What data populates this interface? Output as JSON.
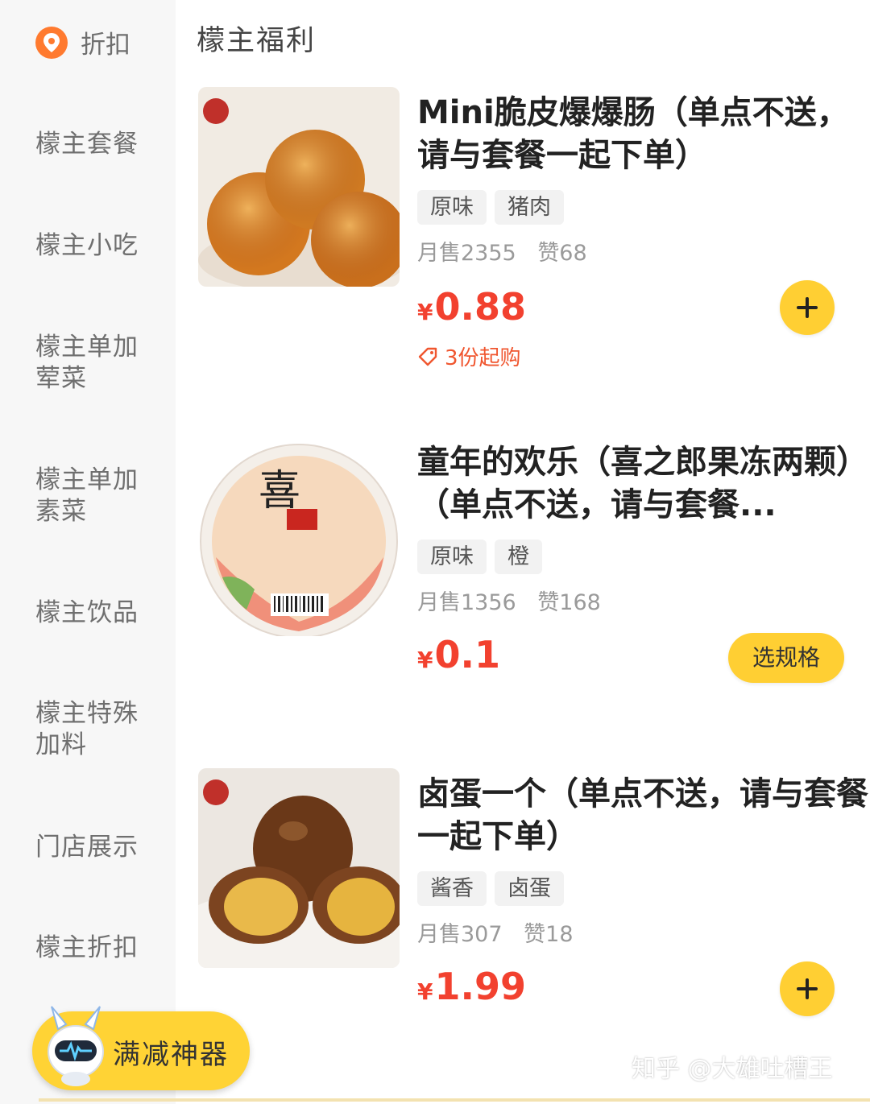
{
  "sidebar": {
    "active": "折扣",
    "items": [
      "檬主套餐",
      "檬主小吃",
      "檬主单加荤菜",
      "檬主单加素菜",
      "檬主饮品",
      "檬主特殊加料",
      "门店展示",
      "檬主折扣"
    ]
  },
  "section_title": "檬主福利",
  "products": [
    {
      "name": "Mini脆皮爆爆肠（单点不送，请与套餐一起下单）",
      "tags": [
        "原味",
        "猪肉"
      ],
      "monthly_sales": "月售2355",
      "likes": "赞68",
      "currency": "¥",
      "price": "0.88",
      "min_buy": "3份起购",
      "action": "+",
      "image": "fried-sausage-balls"
    },
    {
      "name": "童年的欢乐（喜之郎果冻两颗）（单点不送，请与套餐...",
      "tags": [
        "原味",
        "橙"
      ],
      "monthly_sales": "月售1356",
      "likes": "赞168",
      "currency": "¥",
      "price": "0.1",
      "action": "选规格",
      "image": "jelly-cup"
    },
    {
      "name": "卤蛋一个（单点不送，请与套餐一起下单）",
      "tags": [
        "酱香",
        "卤蛋"
      ],
      "monthly_sales": "月售307",
      "likes": "赞18",
      "currency": "¥",
      "price": "1.99",
      "action": "+",
      "image": "braised-egg"
    }
  ],
  "promo": {
    "label": "满减神器"
  },
  "watermark": "知乎 @大雄吐槽王",
  "colors": {
    "accent": "#ffcf33",
    "price": "#f2412f",
    "sidebar_bg": "#f7f7f7"
  }
}
